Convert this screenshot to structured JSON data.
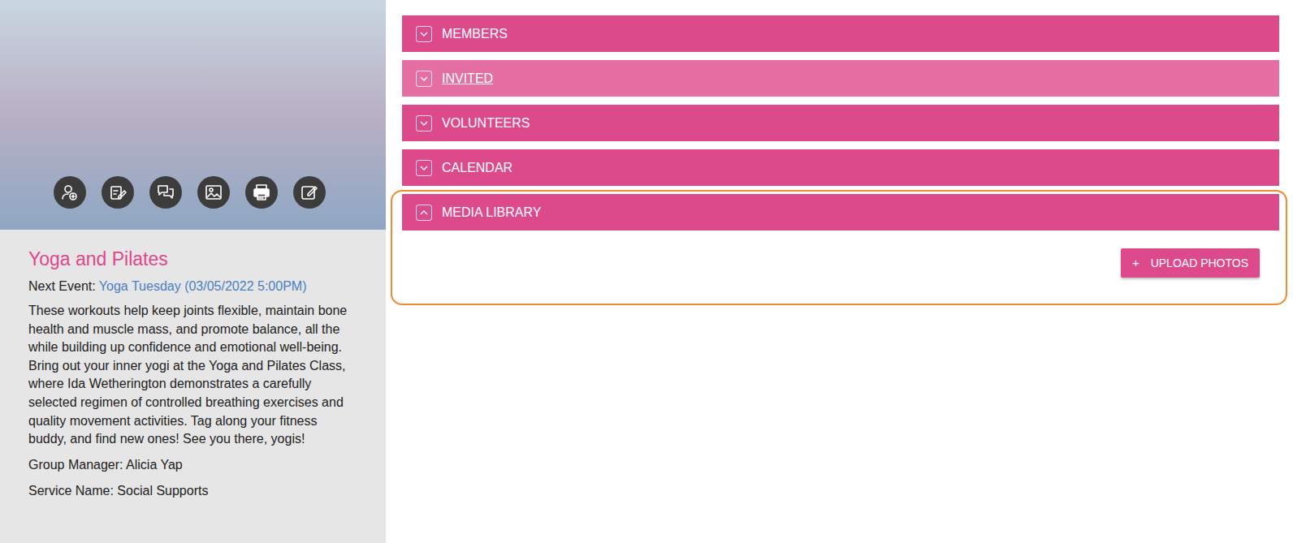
{
  "group": {
    "title": "Yoga and Pilates",
    "next_event_label": "Next Event:",
    "next_event": "Yoga Tuesday (03/05/2022 5:00PM)",
    "description": "These workouts help keep joints flexible, maintain bone health and muscle mass, and promote balance, all the while building up confidence and emotional well-being. Bring out your inner yogi at the Yoga and Pilates Class, where Ida Wetherington demonstrates a carefully selected regimen of controlled breathing exercises and quality movement activities. Tag along your fitness buddy, and find new ones! See you there, yogis!",
    "manager": "Group Manager: Alicia Yap",
    "service": "Service Name: Social Supports"
  },
  "sections": [
    {
      "label": "MEMBERS",
      "expanded": false,
      "highlighted": false,
      "focused": false
    },
    {
      "label": "INVITED",
      "expanded": false,
      "highlighted": true,
      "focused": false
    },
    {
      "label": "VOLUNTEERS",
      "expanded": false,
      "highlighted": false,
      "focused": false
    },
    {
      "label": "CALENDAR",
      "expanded": false,
      "highlighted": false,
      "focused": false
    },
    {
      "label": "MEDIA LIBRARY",
      "expanded": true,
      "highlighted": false,
      "focused": true
    }
  ],
  "upload_button": {
    "icon": "+",
    "label": "UPLOAD PHOTOS"
  }
}
